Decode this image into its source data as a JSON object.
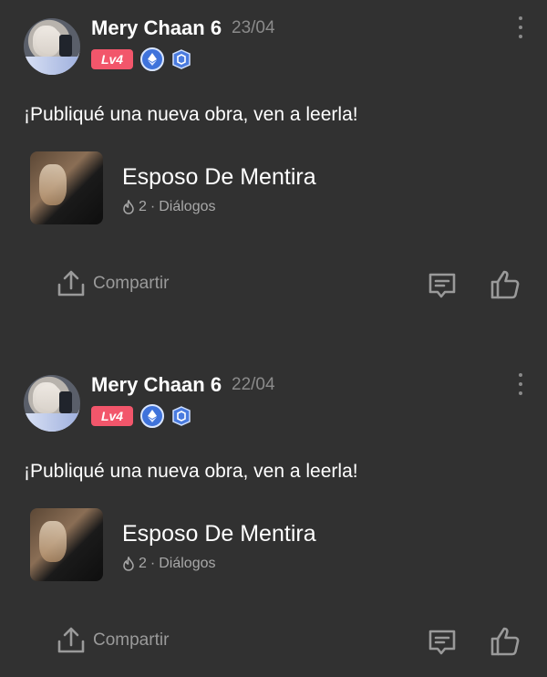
{
  "posts": [
    {
      "author": "Mery Chaan 6",
      "date": "23/04",
      "level_badge": "Lv4",
      "message": "¡Publiqué una nueva obra, ven a leerla!",
      "work": {
        "title": "Esposo De Mentira",
        "count": "2",
        "genre": "Diálogos"
      },
      "share_label": "Compartir"
    },
    {
      "author": "Mery Chaan 6",
      "date": "22/04",
      "level_badge": "Lv4",
      "message": "¡Publiqué una nueva obra, ven a leerla!",
      "work": {
        "title": "Esposo De Mentira",
        "count": "2",
        "genre": "Diálogos"
      },
      "share_label": "Compartir"
    }
  ],
  "colors": {
    "background": "#313131",
    "level_badge": "#f2566b",
    "badge_blue": "#3f73db",
    "muted_text": "#8b8b8b"
  },
  "icons": [
    "more-vertical-icon",
    "ethereum-badge-icon",
    "shield-badge-icon",
    "fire-icon",
    "share-icon",
    "comment-icon",
    "thumbs-up-icon"
  ]
}
